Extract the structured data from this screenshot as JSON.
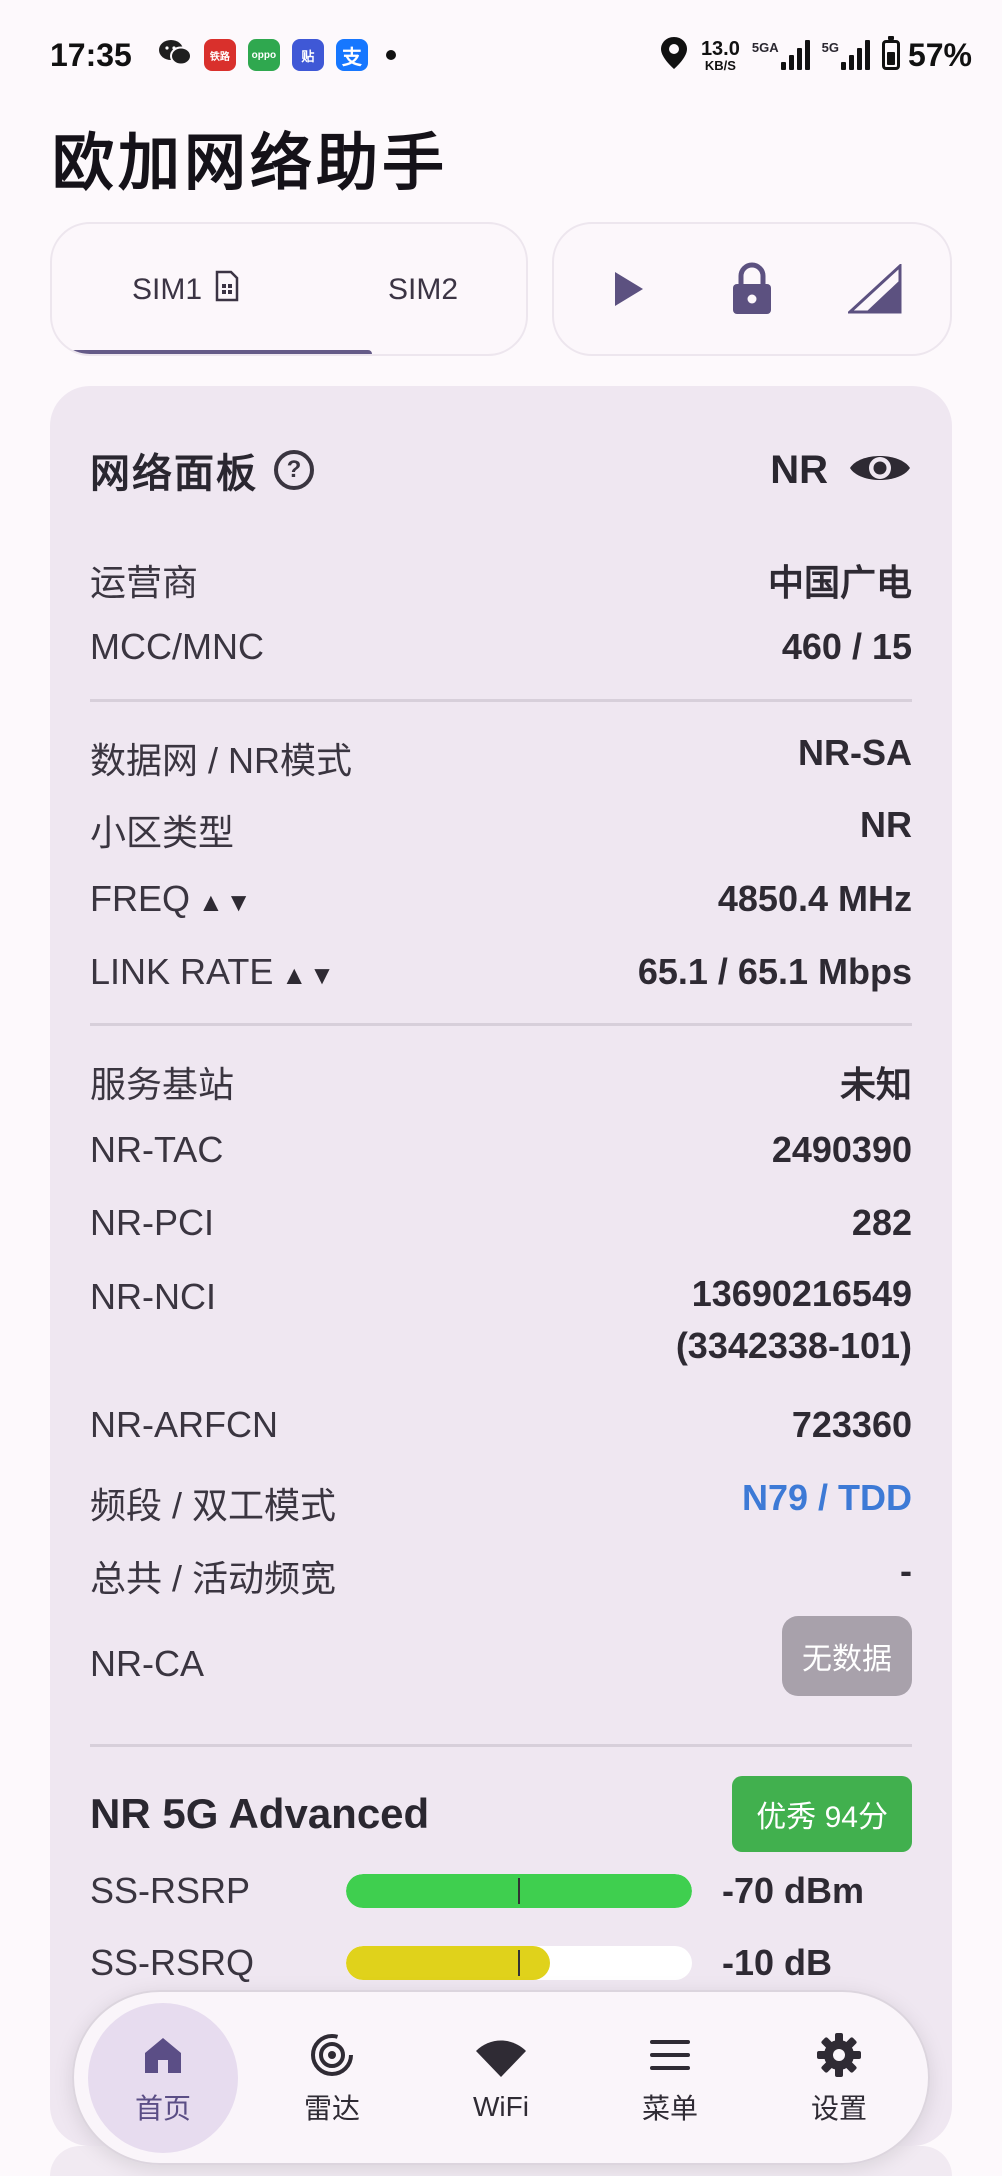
{
  "status_bar": {
    "time": "17:35",
    "app_icons": [
      {
        "name": "wechat-icon",
        "label": "",
        "color": "#2a2a2a"
      },
      {
        "name": "12306-app-icon",
        "label": "铁路",
        "color": "#d9302c"
      },
      {
        "name": "oppo-app-icon",
        "label": "oppo",
        "color": "#2fa84f"
      },
      {
        "name": "tieba-app-icon",
        "label": "贴",
        "color": "#3f58d6"
      },
      {
        "name": "alipay-icon",
        "label": "支",
        "color": "#1677ff"
      }
    ],
    "speed_value": "13.0",
    "speed_unit": "KB/S",
    "sim1_label": "5GA",
    "sim2_label": "5G",
    "battery": "57%",
    "battery_level": 0.57
  },
  "app": {
    "title": "欧加网络助手"
  },
  "sim_tabs": [
    {
      "label": "SIM1"
    },
    {
      "label": "SIM2"
    }
  ],
  "panel": {
    "title": "网络面板",
    "mode": "NR",
    "rows": [
      {
        "key": "运营商",
        "value": "中国广电"
      },
      {
        "key": "MCC/MNC",
        "value": "460 / 15"
      },
      {
        "key": "数据网 / NR模式",
        "value": "NR-SA"
      },
      {
        "key": "小区类型",
        "value": "NR"
      },
      {
        "key": "FREQ",
        "value": "4850.4 MHz",
        "arrows": "▲▼"
      },
      {
        "key": "LINK RATE",
        "value": "65.1 / 65.1 Mbps",
        "arrows": "▲▼"
      },
      {
        "key": "服务基站",
        "value": "未知"
      },
      {
        "key": "NR-TAC",
        "value": "2490390"
      },
      {
        "key": "NR-PCI",
        "value": "282"
      },
      {
        "key": "NR-NCI",
        "value": "13690216549",
        "value2": "(3342338-101)"
      },
      {
        "key": "NR-ARFCN",
        "value": "723360"
      },
      {
        "key": "频段 / 双工模式",
        "value": "N79 / TDD"
      },
      {
        "key": "总共 / 活动频宽",
        "value": "-"
      },
      {
        "key": "NR-CA",
        "value": "无数据"
      }
    ],
    "nr_section": {
      "title": "NR 5G Advanced",
      "score": "优秀 94分",
      "meters": [
        {
          "key": "SS-RSRP",
          "value": "-70 dBm",
          "fill": 1.0,
          "color": "#3fcf4f"
        },
        {
          "key": "SS-RSRQ",
          "value": "-10 dB",
          "fill": 0.59,
          "color": "#e0d21b"
        }
      ]
    }
  },
  "bottom_nav": [
    {
      "label": "首页",
      "icon": "home-icon",
      "active": true
    },
    {
      "label": "雷达",
      "icon": "radar-icon",
      "active": false
    },
    {
      "label": "WiFi",
      "icon": "wifi-icon",
      "active": false
    },
    {
      "label": "菜单",
      "icon": "menu-icon",
      "active": false
    },
    {
      "label": "设置",
      "icon": "gear-icon",
      "active": false
    }
  ]
}
